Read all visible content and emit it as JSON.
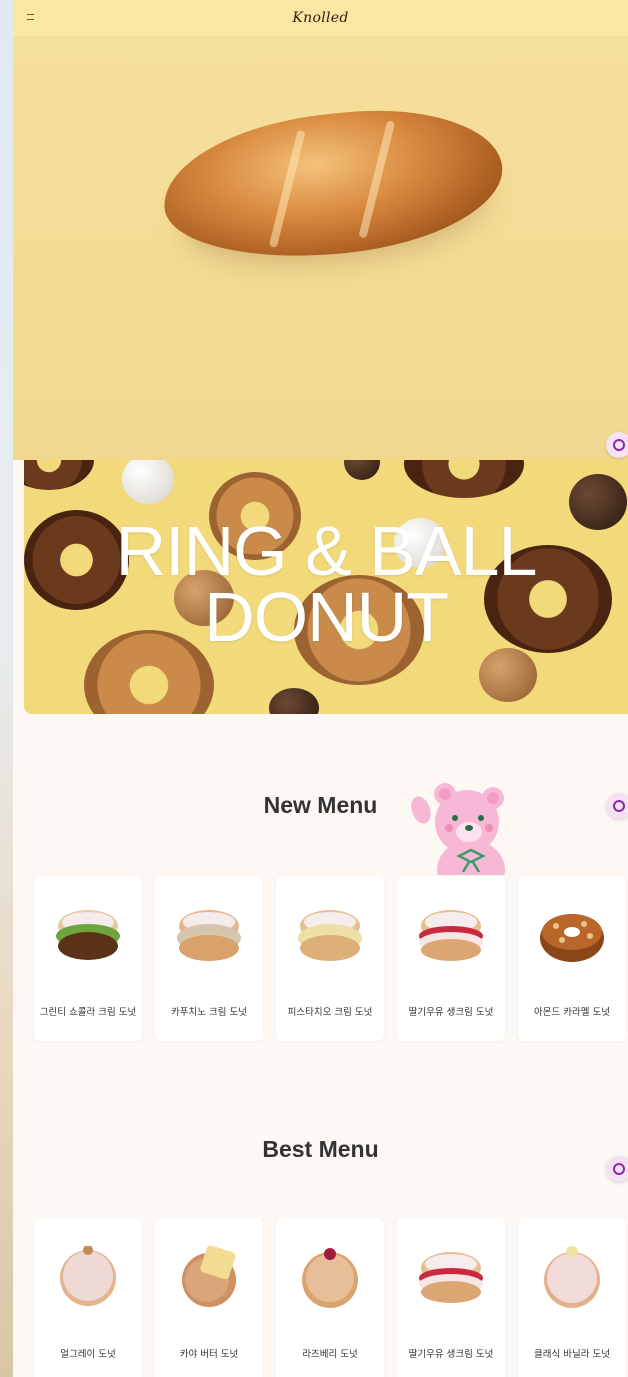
{
  "header": {
    "logo": "Knolled",
    "menu_icon": "hamburger-icon"
  },
  "banner": {
    "title_line1": "RING & BALL",
    "title_line2": "DONUT"
  },
  "new_menu": {
    "title": "New Menu",
    "items": [
      {
        "name": "그린티 쇼콜라 크림 도넛",
        "kind": "matcha-cream"
      },
      {
        "name": "카푸치노 크림 도넛",
        "kind": "cappuccino-cream"
      },
      {
        "name": "피스타치오 크림 도넛",
        "kind": "pistachio-cream"
      },
      {
        "name": "딸기우유 생크림 도넛",
        "kind": "strawberry-cream"
      },
      {
        "name": "아몬드 카라멜 도넛",
        "kind": "almond-caramel"
      }
    ]
  },
  "best_menu": {
    "title": "Best Menu",
    "items": [
      {
        "name": "얼그레이 도넛",
        "kind": "sugar-ball"
      },
      {
        "name": "카야 버터 도넛",
        "kind": "kaya-butter"
      },
      {
        "name": "라즈베리 도넛",
        "kind": "raspberry-ball"
      },
      {
        "name": "딸기우유 생크림 도넛",
        "kind": "strawberry-cream"
      },
      {
        "name": "클래식 바닐라 도넛",
        "kind": "vanilla-ball"
      }
    ]
  },
  "colors": {
    "topbar": "#fbe6a2",
    "hero": "#f4dc96",
    "banner": "#f2d97a",
    "chat": "#8a2aa0"
  }
}
